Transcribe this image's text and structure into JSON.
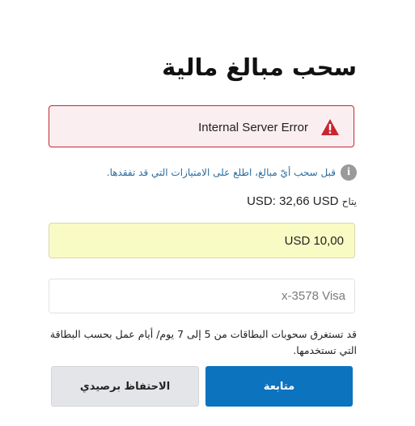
{
  "page": {
    "title": "سحب مبالغ مالية"
  },
  "error": {
    "message": "Internal Server Error",
    "icon": "warning-triangle-icon",
    "color": "#c9262f"
  },
  "info": {
    "icon": "info-icon",
    "link_text": "قبل سحب أيّ مبالغ، اطلع على الامتيازات التي قد تفقدها."
  },
  "balance": {
    "label": "يتاح",
    "value": "USD: 32,66 USD"
  },
  "amount_input": {
    "value": "10,00 USD"
  },
  "card_select": {
    "value": "x-3578 Visa"
  },
  "note": {
    "text": "قد تستغرق سحوبات البطاقات من 5 إلى 7 يوم/ أيام عمل بحسب البطاقة التي تستخدمها."
  },
  "buttons": {
    "continue_label": "متابعة",
    "keep_label": "الاحتفاظ برصيدي",
    "primary_color": "#0c73bf"
  }
}
